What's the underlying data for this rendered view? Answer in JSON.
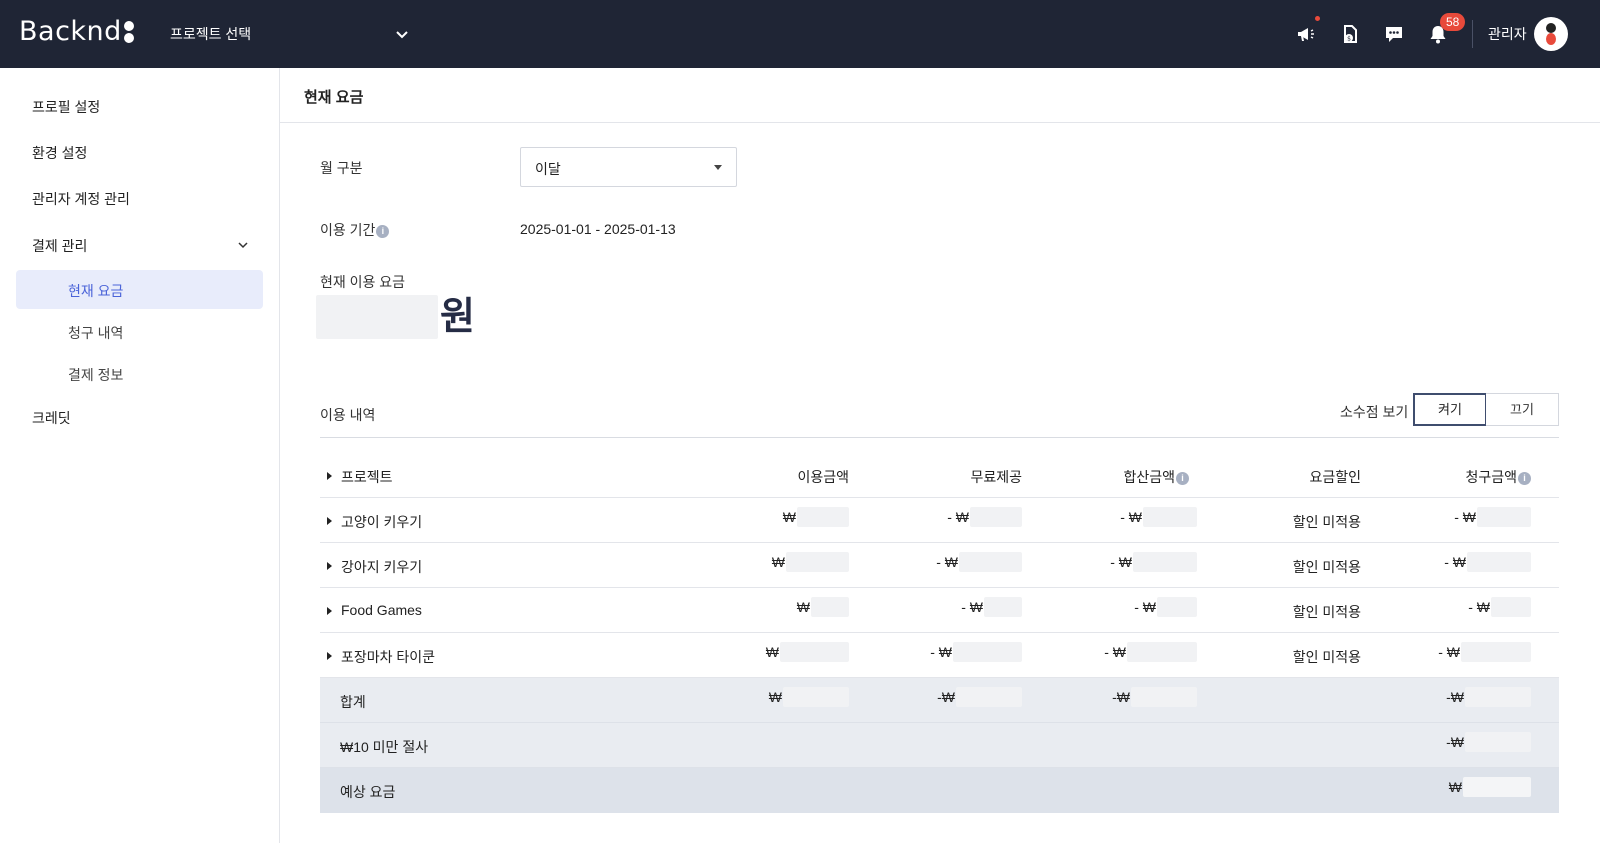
{
  "topbar": {
    "logo": "Backnd",
    "project_select": "프로젝트 선택",
    "notif_count": "58",
    "admin_name": "관리자"
  },
  "sidebar": {
    "profile": "프로필 설정",
    "env": "환경 설정",
    "admin_accounts": "관리자 계정 관리",
    "billing": "결제 관리",
    "current_fee": "현재 요금",
    "invoices": "청구 내역",
    "payment_info": "결제 정보",
    "credit": "크레딧"
  },
  "main": {
    "title": "현재 요금",
    "month_label": "월 구분",
    "month_value": "이달",
    "period_label": "이용 기간",
    "period_value": "2025-01-01 - 2025-01-13",
    "current_fee_label": "현재 이용 요금",
    "won": "원",
    "usage_label": "이용 내역",
    "decimal_label": "소수점 보기",
    "toggle_on": "켜기",
    "toggle_off": "끄기"
  },
  "table": {
    "headers": {
      "project": "프로젝트",
      "usage": "이용금액",
      "free": "무료제공",
      "subtotal": "합산금액",
      "discount": "요금할인",
      "billed": "청구금액"
    },
    "rows": [
      {
        "name": "고양이 키우기",
        "usage": "₩",
        "free": "- ₩",
        "subtotal": "- ₩",
        "discount": "할인 미적용",
        "billed": "- ₩"
      },
      {
        "name": "강아지 키우기",
        "usage": "₩",
        "free": "- ₩",
        "subtotal": "- ₩",
        "discount": "할인 미적용",
        "billed": "- ₩"
      },
      {
        "name": "Food Games",
        "usage": "₩",
        "free": "- ₩",
        "subtotal": "- ₩",
        "discount": "할인 미적용",
        "billed": "- ₩"
      },
      {
        "name": "포장마차 타이쿤",
        "usage": "₩",
        "free": "- ₩",
        "subtotal": "- ₩",
        "discount": "할인 미적용",
        "billed": "- ₩"
      }
    ],
    "total": {
      "name": "합계",
      "usage": "₩",
      "free": "-₩",
      "subtotal": "-₩",
      "billed": "-₩"
    },
    "truncation": {
      "name": "₩10 미만 절사",
      "billed": "-₩"
    },
    "estimate": {
      "name": "예상 요금",
      "billed": "₩"
    }
  }
}
